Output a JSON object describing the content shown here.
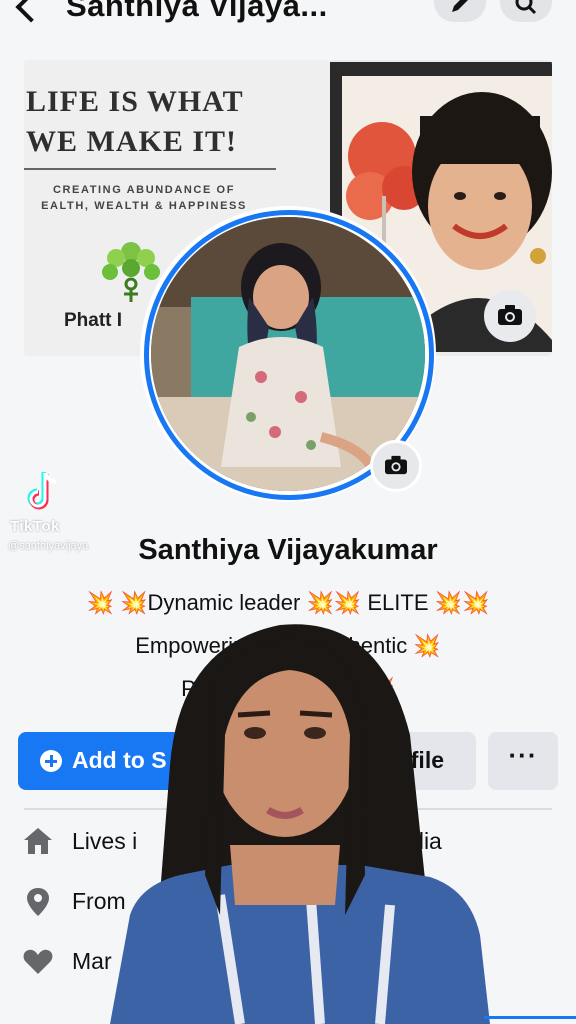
{
  "header": {
    "title": "Santhiya Vijaya...",
    "icons": [
      "back-icon",
      "edit-icon",
      "search-icon"
    ]
  },
  "cover": {
    "headline": "LIFE IS WHAT\nWE MAKE IT!",
    "subline": "CREATING ABUNDANCE OF\nEALTH, WEALTH & HAPPINESS",
    "brand": "Phatt I"
  },
  "watermark": {
    "app": "TikTok",
    "handle": "@santhiyavijaya"
  },
  "profile": {
    "name": "Santhiya Vijayakumar",
    "bio_line1": "💥 💥Dynamic leader 💥💥 ELITE 💥💥",
    "bio_line2": "Empowering ot          💥Authentic  💥",
    "bio_line3": "Passionat                    SFUL💥💥"
  },
  "actions": {
    "add_story": "Add to S",
    "edit_profile": "rofile",
    "more": "···"
  },
  "details": {
    "lives_in": "Lives i",
    "lives_in_suffix": "tralia",
    "from": "From",
    "married": "Mar"
  },
  "colors": {
    "accent": "#1877f2",
    "button_gray": "#e4e6eb",
    "background": "#f5f6f8"
  }
}
